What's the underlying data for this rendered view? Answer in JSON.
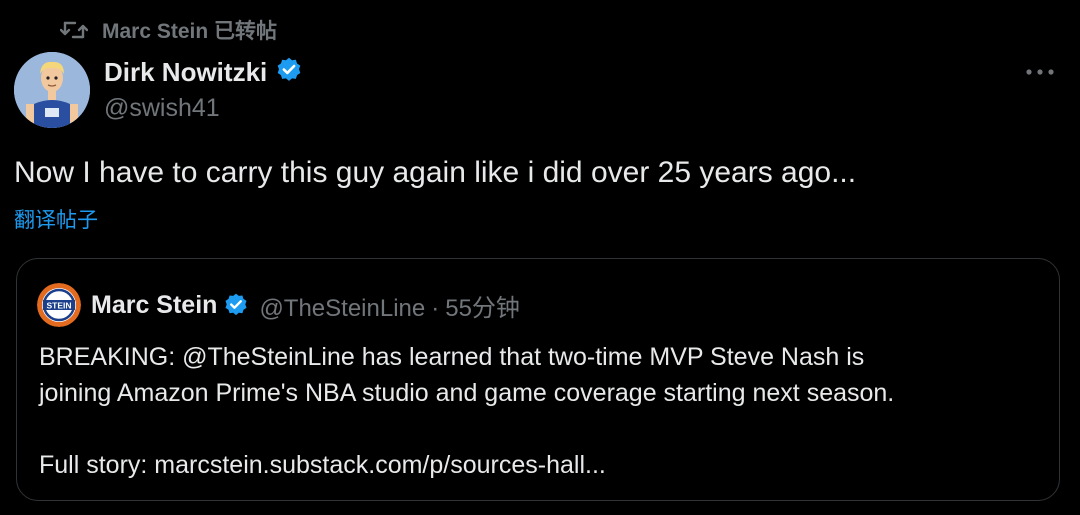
{
  "repost": {
    "text": "Marc Stein 已转帖",
    "icon": "repost-icon"
  },
  "author": {
    "name": "Dirk Nowitzki",
    "handle": "@swish41",
    "verified": true,
    "avatar": "cartoon-player-avatar"
  },
  "tweet": {
    "text": "Now I have to carry this guy again like i did over 25 years ago...",
    "translate_label": "翻译帖子"
  },
  "quote": {
    "name": "Marc Stein",
    "handle": "@TheSteinLine",
    "separator": "·",
    "time": "55分钟",
    "avatar_text": "STEIN",
    "body_line1": "BREAKING: @TheSteinLine has learned that two-time MVP Steve Nash is",
    "body_line2": "joining Amazon Prime's NBA studio and game coverage starting next season.",
    "body_line3": "Full story: marcstein.substack.com/p/sources-hall..."
  },
  "colors": {
    "background": "#000000",
    "text": "#e7e9ea",
    "muted": "#71767b",
    "accent": "#1d9bf0",
    "border": "#2f3336",
    "quote_avatar": "#e36b1f"
  }
}
